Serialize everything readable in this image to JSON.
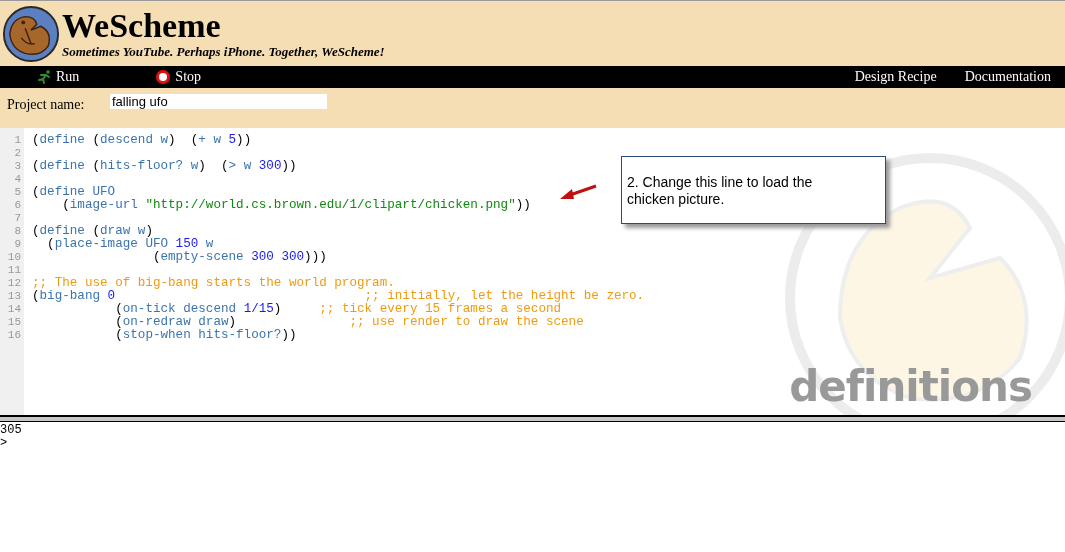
{
  "header": {
    "title": "WeScheme",
    "tagline": "Sometimes YouTube. Perhaps iPhone. Together, WeScheme!"
  },
  "toolbar": {
    "left": [
      {
        "kind": "run",
        "label": "Run"
      },
      {
        "kind": "stop",
        "label": "Stop"
      }
    ],
    "right": [
      {
        "label": "Design Recipe"
      },
      {
        "label": "Documentation"
      }
    ]
  },
  "project": {
    "label": "Project name:",
    "value": "falling ufo"
  },
  "editor": {
    "watermark": "definitions",
    "lines": [
      {
        "number": "1",
        "tokens": [
          {
            "kind": "p",
            "text": "("
          },
          {
            "kind": "k",
            "text": "define"
          },
          {
            "kind": "p",
            "text": " ("
          },
          {
            "kind": "k",
            "text": "descend w"
          },
          {
            "kind": "p",
            "text": ")  ("
          },
          {
            "kind": "k",
            "text": "+ w "
          },
          {
            "kind": "n",
            "text": "5"
          },
          {
            "kind": "p",
            "text": "))"
          }
        ]
      },
      {
        "number": "2"
      },
      {
        "number": "3",
        "tokens": [
          {
            "kind": "p",
            "text": "("
          },
          {
            "kind": "k",
            "text": "define"
          },
          {
            "kind": "p",
            "text": " ("
          },
          {
            "kind": "k",
            "text": "hits-floor? w"
          },
          {
            "kind": "p",
            "text": ")  ("
          },
          {
            "kind": "k",
            "text": "> w "
          },
          {
            "kind": "n",
            "text": "300"
          },
          {
            "kind": "p",
            "text": "))"
          }
        ]
      },
      {
        "number": "4"
      },
      {
        "number": "5",
        "tokens": [
          {
            "kind": "p",
            "text": "("
          },
          {
            "kind": "k",
            "text": "define UFO"
          }
        ]
      },
      {
        "number": "6",
        "tokens": [
          {
            "kind": "p",
            "text": "    ("
          },
          {
            "kind": "k",
            "text": "image-url "
          },
          {
            "kind": "s",
            "text": "\"http://world.cs.brown.edu/1/clipart/chicken.png\""
          },
          {
            "kind": "p",
            "text": "))"
          }
        ]
      },
      {
        "number": "7"
      },
      {
        "number": "8",
        "tokens": [
          {
            "kind": "p",
            "text": "("
          },
          {
            "kind": "k",
            "text": "define"
          },
          {
            "kind": "p",
            "text": " ("
          },
          {
            "kind": "k",
            "text": "draw w"
          },
          {
            "kind": "p",
            "text": ")"
          }
        ]
      },
      {
        "number": "9",
        "tokens": [
          {
            "kind": "p",
            "text": "  ("
          },
          {
            "kind": "k",
            "text": "place-image UFO "
          },
          {
            "kind": "n",
            "text": "150"
          },
          {
            "kind": "k",
            "text": " w"
          }
        ]
      },
      {
        "number": "10",
        "tokens": [
          {
            "kind": "p",
            "text": "                ("
          },
          {
            "kind": "k",
            "text": "empty-scene "
          },
          {
            "kind": "n",
            "text": "300 300"
          },
          {
            "kind": "p",
            "text": ")))"
          }
        ]
      },
      {
        "number": "11"
      },
      {
        "number": "12",
        "tokens": [
          {
            "kind": "c",
            "text": ";; The use of big-bang starts the world program."
          }
        ]
      },
      {
        "number": "13",
        "tokens": [
          {
            "kind": "p",
            "text": "("
          },
          {
            "kind": "k",
            "text": "big-bang "
          },
          {
            "kind": "n",
            "text": "0"
          },
          {
            "kind": "c",
            "text": "                                 ;; initially, let the height be zero."
          }
        ]
      },
      {
        "number": "14",
        "tokens": [
          {
            "kind": "p",
            "text": "           ("
          },
          {
            "kind": "k",
            "text": "on-tick descend "
          },
          {
            "kind": "n",
            "text": "1/15"
          },
          {
            "kind": "p",
            "text": ")     "
          },
          {
            "kind": "c",
            "text": ";; tick every 15 frames a second"
          }
        ]
      },
      {
        "number": "15",
        "tokens": [
          {
            "kind": "p",
            "text": "           ("
          },
          {
            "kind": "k",
            "text": "on-redraw draw"
          },
          {
            "kind": "p",
            "text": ")               "
          },
          {
            "kind": "c",
            "text": ";; use render to draw the scene"
          }
        ]
      },
      {
        "number": "16",
        "tokens": [
          {
            "kind": "p",
            "text": "           ("
          },
          {
            "kind": "k",
            "text": "stop-when hits-floor?"
          },
          {
            "kind": "p",
            "text": "))"
          }
        ]
      }
    ]
  },
  "callout": {
    "text": "2. Change this line to load the chicken picture."
  },
  "interactions": {
    "lines": [
      "305",
      ">"
    ]
  }
}
